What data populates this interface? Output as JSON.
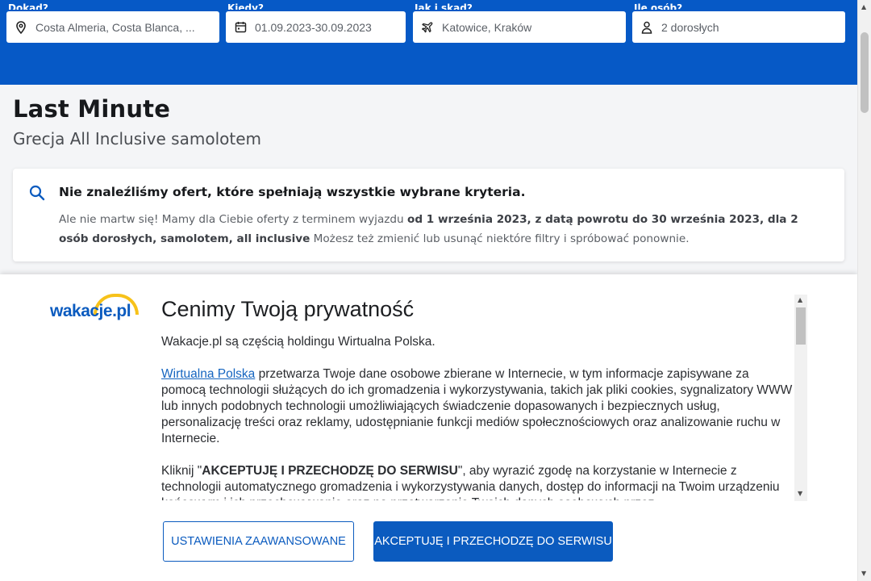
{
  "search": {
    "destination": {
      "label": "Dokąd?",
      "value": "Costa Almeria, Costa Blanca, ...",
      "icon": "location-pin-icon"
    },
    "dates": {
      "label": "Kiedy?",
      "value": "01.09.2023-30.09.2023",
      "icon": "calendar-icon"
    },
    "transport": {
      "label": "Jak i skąd?",
      "value": "Katowice, Kraków",
      "icon": "airplane-icon"
    },
    "guests": {
      "label": "Ile osób?",
      "value": "2 dorosłych",
      "icon": "person-icon"
    }
  },
  "main": {
    "title": "Last Minute",
    "subtitle": "Grecja All Inclusive samolotem"
  },
  "notice": {
    "heading": "Nie znaleźliśmy ofert, które spełniają wszystkie wybrane kryteria.",
    "body_intro": "Ale nie martw się! Mamy dla Ciebie oferty z terminem wyjazdu ",
    "body_bold": "od 1 września 2023, z datą powrotu do 30 września 2023, dla 2 osób dorosłych, samolotem, all inclusive",
    "body_outro": " Możesz też zmienić lub usunąć niektóre filtry i spróbować ponownie."
  },
  "consent": {
    "logo_text": "wakacje.pl",
    "title": "Cenimy Twoją prywatność",
    "p1": "Wakacje.pl są częścią holdingu Wirtualna Polska.",
    "p2_link": "Wirtualna Polska",
    "p2_rest": " przetwarza Twoje dane osobowe zbierane w Internecie, w tym informacje zapisywane za pomocą technologii służących do ich gromadzenia i wykorzystywania, takich jak pliki cookies, sygnalizatory WWW lub innych podobnych technologii umożliwiających świadczenie dopasowanych i bezpiecznych usług, personalizację treści oraz reklamy, udostępnianie funkcji mediów społecznościowych oraz analizowanie ruchu w Internecie.",
    "p3_pre": "Kliknij \"",
    "p3_bold": "AKCEPTUJĘ I PRZECHODZĘ DO SERWISU",
    "p3_post": "\", aby wyrazić zgodę na korzystanie w Internecie z technologii automatycznego gromadzenia i wykorzystywania danych, dostęp do informacji na Twoim urządzeniu końcowym i ich przechowywanie oraz na przetwarzanie Twoich danych osobowych przez",
    "btn_advanced": "USTAWIENIA ZAAWANSOWANE",
    "btn_accept": "AKCEPTUJĘ I PRZECHODZĘ DO SERWISU"
  },
  "colors": {
    "brand_blue": "#0659c6",
    "accent_yellow": "#f7c21a"
  }
}
